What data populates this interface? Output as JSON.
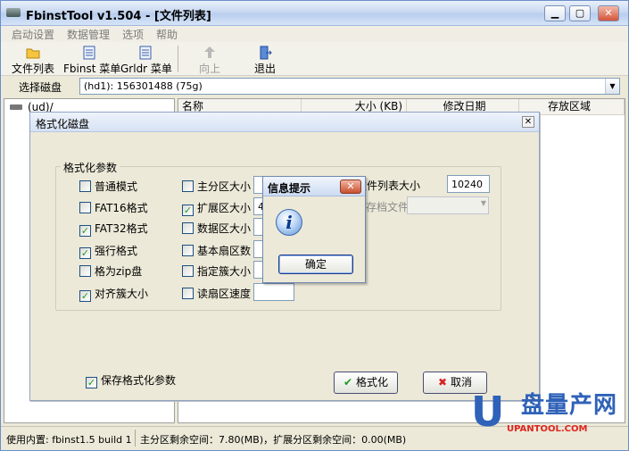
{
  "window": {
    "title": "FbinstTool v1.504 - [文件列表]",
    "min_glyph": "▁",
    "max_glyph": "▢",
    "close_glyph": "✕"
  },
  "menu": [
    "启动设置",
    "数据管理",
    "选项",
    "帮助"
  ],
  "toolbar": {
    "file_list": "文件列表",
    "fbinst_menu": "Fbinst 菜单",
    "grldr_menu": "Grldr 菜单",
    "up": "向上",
    "exit": "退出"
  },
  "disk": {
    "label": "选择磁盘",
    "value": "(hd1): 156301488 (75g)"
  },
  "tree": {
    "root": "(ud)/"
  },
  "list": {
    "columns": [
      "名称",
      "大小 (KB)",
      "修改日期",
      "存放区域"
    ]
  },
  "status": {
    "builtin": "使用内置: fbinst1.5 build 1",
    "free": "主分区剩余空间：7.80(MB)，扩展分区剩余空间：0.00(MB)"
  },
  "format_dialog": {
    "title": "格式化磁盘",
    "close": "✕",
    "group": "格式化参数",
    "col1": [
      {
        "label": "普通模式",
        "checked": false
      },
      {
        "label": "FAT16格式",
        "checked": false
      },
      {
        "label": "FAT32格式",
        "checked": true
      },
      {
        "label": "强行格式",
        "checked": true
      },
      {
        "label": "格为zip盘",
        "checked": false
      },
      {
        "label": "对齐簇大小",
        "checked": true
      }
    ],
    "col2": [
      {
        "label": "主分区大小",
        "checked": false,
        "value": ""
      },
      {
        "label": "扩展区大小",
        "checked": true,
        "value": "40"
      },
      {
        "label": "数据区大小",
        "checked": false,
        "value": ""
      },
      {
        "label": "基本扇区数",
        "checked": false,
        "value": ""
      },
      {
        "label": "指定簇大小",
        "checked": false,
        "value": ""
      },
      {
        "label": "读扇区速度",
        "checked": false,
        "value": ""
      }
    ],
    "filelist_size_label": "文件列表大小",
    "filelist_size_value": "10240",
    "archive_label": "存档文件",
    "save_params": {
      "label": "保存格式化参数",
      "checked": true
    },
    "format_btn": "格式化",
    "cancel_btn": "取消"
  },
  "info_box": {
    "title": "信息提示",
    "close": "✕",
    "ok": "确定"
  },
  "watermark": {
    "brand": "盘量产网",
    "url": "UPANTOOL.COM"
  }
}
